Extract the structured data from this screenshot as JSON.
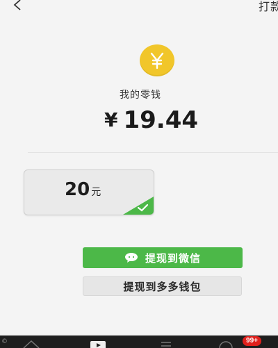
{
  "header": {
    "back_icon": "chevron-left-icon",
    "right_label": "打款"
  },
  "balance": {
    "icon": "yen-coin-icon",
    "label": "我的零钱",
    "currency_symbol": "¥",
    "amount": "19.44"
  },
  "options": [
    {
      "value": "20",
      "unit": "元",
      "selected": true
    }
  ],
  "actions": {
    "wechat_label": "提现到微信",
    "wallet_label": "提现到多多钱包"
  },
  "tabbar": {
    "badge": "99+"
  },
  "colors": {
    "coin": "#f1c62a",
    "wechat_green": "#4cb848",
    "selected_corner": "#4cb848",
    "badge_red": "#e0201c"
  }
}
